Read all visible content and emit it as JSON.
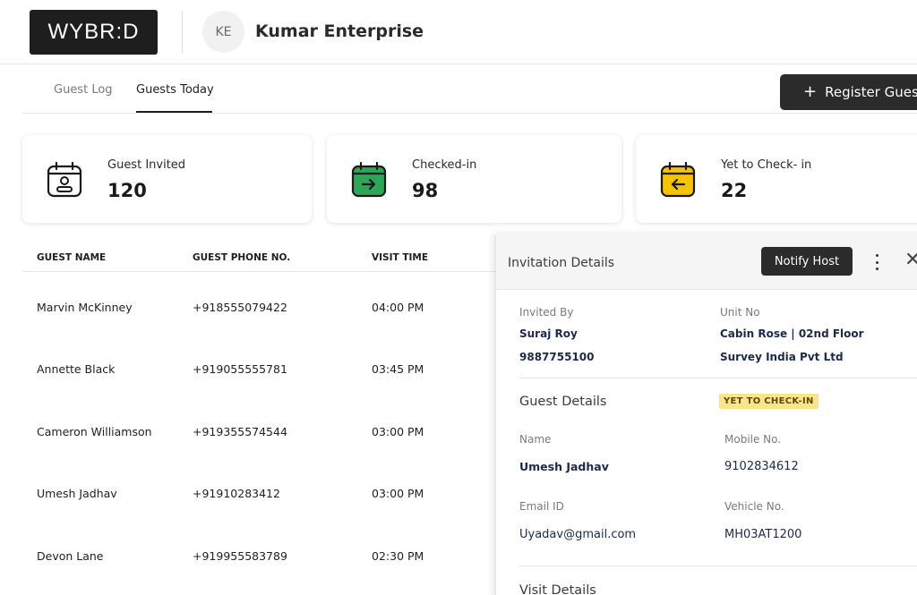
{
  "header": {
    "logo_text": "WYBR:D",
    "avatar_initials": "KE",
    "company_name": "Kumar Enterprise"
  },
  "tabs": [
    {
      "label": "Guest Log",
      "active": false
    },
    {
      "label": "Guests Today",
      "active": true
    }
  ],
  "register_button": {
    "label": "Register Guest"
  },
  "stats": [
    {
      "label": "Guest Invited",
      "value": "120",
      "icon": "calendar-person-icon",
      "color": "#ffffff"
    },
    {
      "label": "Checked-in",
      "value": "98",
      "icon": "calendar-arrow-right-icon",
      "color": "#2ea65a"
    },
    {
      "label": "Yet to Check- in",
      "value": "22",
      "icon": "calendar-arrow-left-icon",
      "color": "#f5c400"
    }
  ],
  "table": {
    "columns": [
      "GUEST NAME",
      "GUEST PHONE NO.",
      "VISIT TIME"
    ],
    "rows": [
      [
        "Marvin McKinney",
        "+918555079422",
        "04:00 PM"
      ],
      [
        "Annette Black",
        "+919055555781",
        "03:45 PM"
      ],
      [
        "Cameron Williamson",
        "+919355574544",
        "03:00 PM"
      ],
      [
        "Umesh Jadhav",
        "+91910283412",
        "03:00 PM"
      ],
      [
        "Devon Lane",
        "+919955583789",
        "02:30 PM"
      ]
    ]
  },
  "panel": {
    "title": "Invitation Details",
    "notify_label": "Notify Host",
    "invited_by_label": "Invited By",
    "invited_by_name": "Suraj Roy",
    "invited_by_phone": "9887755100",
    "unit_label": "Unit No",
    "unit_value": "Cabin Rose | 02nd Floor",
    "unit_company": "Survey India Pvt Ltd",
    "guest_details_title": "Guest Details",
    "status_badge": "YET TO CHECK-IN",
    "name_label": "Name",
    "name_value": "Umesh Jadhav",
    "mobile_label": "Mobile No.",
    "mobile_value": "9102834612",
    "email_label": "Email ID",
    "email_value": "Uyadav@gmail.com",
    "vehicle_label": "Vehicle No.",
    "vehicle_value": "MH03AT1200",
    "visit_details_title": "Visit Details"
  },
  "colors": {
    "dark": "#2b2b2b",
    "green": "#2ea65a",
    "yellow": "#f5c400",
    "badge": "#fbe48a",
    "navy_text": "#1c2a4a"
  }
}
